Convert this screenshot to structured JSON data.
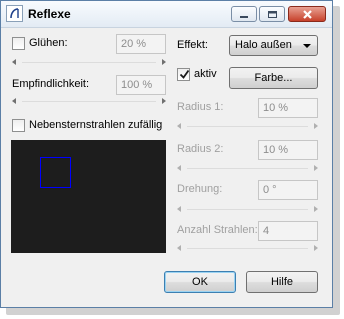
{
  "window": {
    "title": "Reflexe"
  },
  "glow": {
    "label": "Glühen:",
    "checked": false,
    "value": "20 %"
  },
  "sensitivity": {
    "label": "Empfindlichkeit:",
    "value": "100 %"
  },
  "random_rays": {
    "label": "Nebensternstrahlen zufällig",
    "checked": false
  },
  "effect": {
    "label": "Effekt:",
    "selected": "Halo außen"
  },
  "active": {
    "label": "aktiv",
    "checked": true
  },
  "color_button": {
    "label": "Farbe..."
  },
  "radius1": {
    "label": "Radius 1:",
    "value": "10 %"
  },
  "radius2": {
    "label": "Radius 2:",
    "value": "10 %"
  },
  "rotation": {
    "label": "Drehung:",
    "value": "0 °"
  },
  "ray_count": {
    "label": "Anzahl Strahlen:",
    "value": "4"
  },
  "buttons": {
    "ok": "OK",
    "help": "Hilfe"
  },
  "colors": {
    "preview_background": "#1d1d1d",
    "preview_rect": "#0000ff",
    "disabled_text": "#a0a0a0"
  },
  "icons": {
    "app": "reflex-curve-icon",
    "minimize": "minimize-icon",
    "maximize": "maximize-icon",
    "close": "close-icon",
    "check": "checkmark-icon"
  }
}
